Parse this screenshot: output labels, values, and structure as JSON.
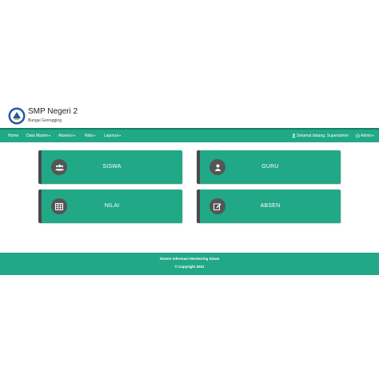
{
  "header": {
    "school_name": "SMP Negeri 2",
    "school_location": "Bungai Gerregging"
  },
  "navbar": {
    "items": [
      {
        "label": "Home",
        "dropdown": false
      },
      {
        "label": "Data Master",
        "dropdown": true
      },
      {
        "label": "Absensi",
        "dropdown": true
      },
      {
        "label": "Nilai",
        "dropdown": true
      },
      {
        "label": "Laporan",
        "dropdown": true
      }
    ],
    "greeting": "Selamat datang, Superadmin",
    "admin_label": "Admin"
  },
  "cards": [
    {
      "label": "SISWA",
      "icon": "users-icon"
    },
    {
      "label": "GURU",
      "icon": "user-icon"
    },
    {
      "label": "NILAI",
      "icon": "table-icon"
    },
    {
      "label": "ABSEN",
      "icon": "edit-icon"
    }
  ],
  "footer": {
    "line1": "Sistem Informasi Monitoring Siswa",
    "line2": "© Copyright 2021"
  },
  "colors": {
    "primary": "#21a887",
    "navbar_border": "#1a7f68",
    "card_accent": "#4a4a4a",
    "icon_circle": "#555555"
  }
}
